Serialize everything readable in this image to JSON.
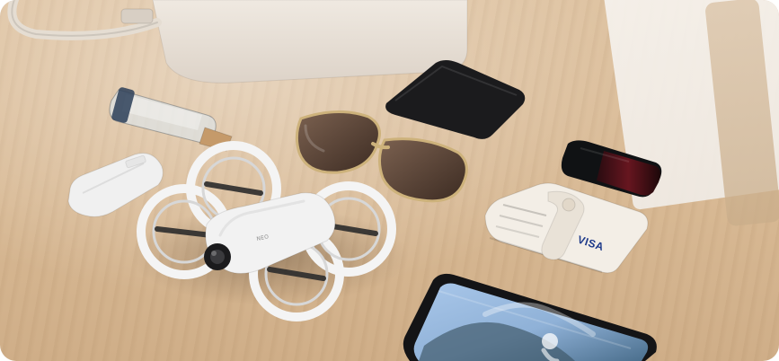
{
  "scene": {
    "card_brand_text": "VISA",
    "drone_label_text": "NEO"
  },
  "colors": {
    "table_wood": "#d8b994",
    "bag_cream": "#e8e1d9",
    "device_black": "#1b1b1d",
    "drone_white": "#f2f2f2"
  },
  "icons": {
    "drone": "drone-icon",
    "phone": "phone-icon",
    "wallet": "wallet-icon"
  }
}
